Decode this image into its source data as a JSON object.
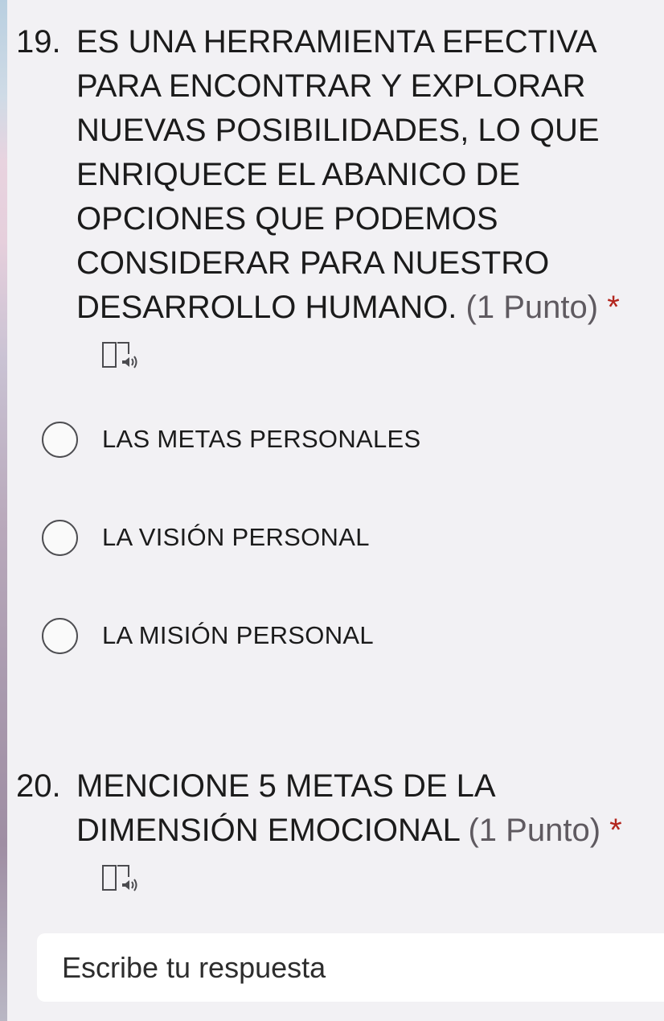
{
  "questions": [
    {
      "number": "19.",
      "text": "ES UNA HERRAMIENTA EFECTIVA PARA ENCONTRAR Y EXPLORAR NUEVAS POSIBILIDADES, LO QUE ENRIQUECE EL ABANICO DE OPCIONES QUE PODEMOS CONSIDERAR PARA NUESTRO DESARROLLO HUMANO.",
      "points": "(1 Punto)",
      "required": "*",
      "reader_icon": "immersive-reader-icon",
      "options": [
        "LAS METAS PERSONALES",
        "LA VISIÓN PERSONAL",
        "LA MISIÓN PERSONAL"
      ]
    },
    {
      "number": "20.",
      "text": "MENCIONE 5 METAS DE LA DIMENSIÓN EMOCIONAL",
      "points": "(1 Punto)",
      "required": "*",
      "reader_icon": "immersive-reader-icon",
      "answer_placeholder": "Escribe tu respuesta"
    }
  ],
  "colors": {
    "background": "#f2f1f4",
    "required": "#b3261e",
    "points": "#5f5a60"
  }
}
